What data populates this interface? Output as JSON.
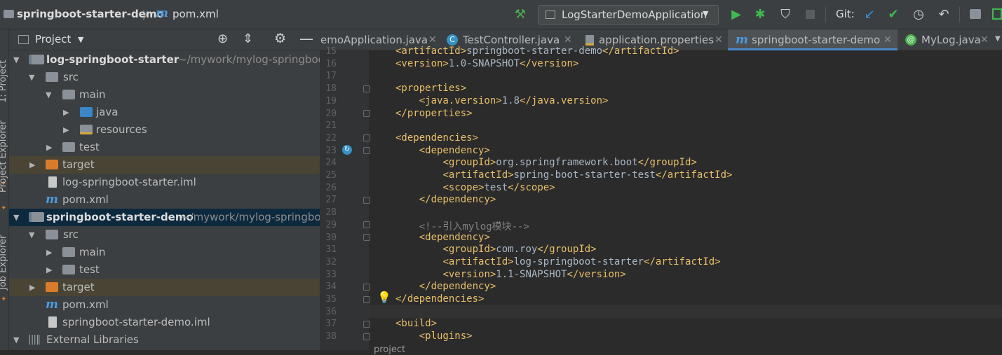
{
  "navbar": {
    "breadcrumb_project": "springboot-starter-demo",
    "breadcrumb_separator": "〉",
    "breadcrumb_file_icon": "m",
    "breadcrumb_file": "pom.xml",
    "run_config": "LogStarterDemoApplication",
    "vcs_label": "Git:"
  },
  "sidestrip": {
    "project_label": "1: Project",
    "explorer_label": "Project Explorer",
    "job_label": "Job Explorer"
  },
  "project_panel": {
    "title": "Project",
    "tree": [
      {
        "label": "log-springboot-starter",
        "path": " ~/mywork/mylog-springboot"
      },
      {
        "label": "src"
      },
      {
        "label": "main"
      },
      {
        "label": "java"
      },
      {
        "label": "resources"
      },
      {
        "label": "test"
      },
      {
        "label": "target"
      },
      {
        "label": "log-springboot-starter.iml"
      },
      {
        "label": "pom.xml"
      },
      {
        "label": "springboot-starter-demo",
        "path": " ~/mywork/mylog-springbo"
      },
      {
        "label": "src"
      },
      {
        "label": "main"
      },
      {
        "label": "test"
      },
      {
        "label": "target"
      },
      {
        "label": "pom.xml"
      },
      {
        "label": "springboot-starter-demo.iml"
      },
      {
        "label": "External Libraries"
      }
    ]
  },
  "tabs": [
    {
      "label": "emoApplication.java",
      "icon": "java-class-icon"
    },
    {
      "label": "TestController.java",
      "icon": "class-icon"
    },
    {
      "label": "application.properties",
      "icon": "properties-icon"
    },
    {
      "label": "springboot-starter-demo",
      "icon": "maven-icon"
    },
    {
      "label": "MyLog.java",
      "icon": "annotation-icon"
    }
  ],
  "code_lines": [
    {
      "n": "15",
      "text": "<artifactId>springboot-starter-demo</artifactId>"
    },
    {
      "n": "16",
      "text": "<version>1.0-SNAPSHOT</version>"
    },
    {
      "n": "17",
      "text": ""
    },
    {
      "n": "18",
      "text": "<properties>"
    },
    {
      "n": "19",
      "text": "    <java.version>1.8</java.version>"
    },
    {
      "n": "20",
      "text": "</properties>"
    },
    {
      "n": "21",
      "text": ""
    },
    {
      "n": "22",
      "text": "<dependencies>"
    },
    {
      "n": "23",
      "text": "    <dependency>"
    },
    {
      "n": "24",
      "text": "        <groupId>org.springframework.boot</groupId>"
    },
    {
      "n": "25",
      "text": "        <artifactId>spring-boot-starter-test</artifactId>"
    },
    {
      "n": "26",
      "text": "        <scope>test</scope>"
    },
    {
      "n": "27",
      "text": "    </dependency>"
    },
    {
      "n": "28",
      "text": ""
    },
    {
      "n": "29",
      "text": "    <!--引入mylog模块-->"
    },
    {
      "n": "30",
      "text": "    <dependency>"
    },
    {
      "n": "31",
      "text": "        <groupId>com.roy</groupId>"
    },
    {
      "n": "32",
      "text": "        <artifactId>log-springboot-starter</artifactId>"
    },
    {
      "n": "33",
      "text": "        <version>1.1-SNAPSHOT</version>"
    },
    {
      "n": "34",
      "text": "    </dependency>"
    },
    {
      "n": "35",
      "text": "</dependencies>"
    },
    {
      "n": "36",
      "text": ""
    },
    {
      "n": "37",
      "text": "<build>"
    },
    {
      "n": "38",
      "text": "    <plugins>"
    }
  ],
  "bottom_breadcrumb": "project",
  "colors": {
    "accent": "#4a88c7",
    "xml_tag": "#e8bf6a",
    "comment": "#808080",
    "run_green": "#3fb950",
    "bulb_yellow": "#f0c419"
  }
}
